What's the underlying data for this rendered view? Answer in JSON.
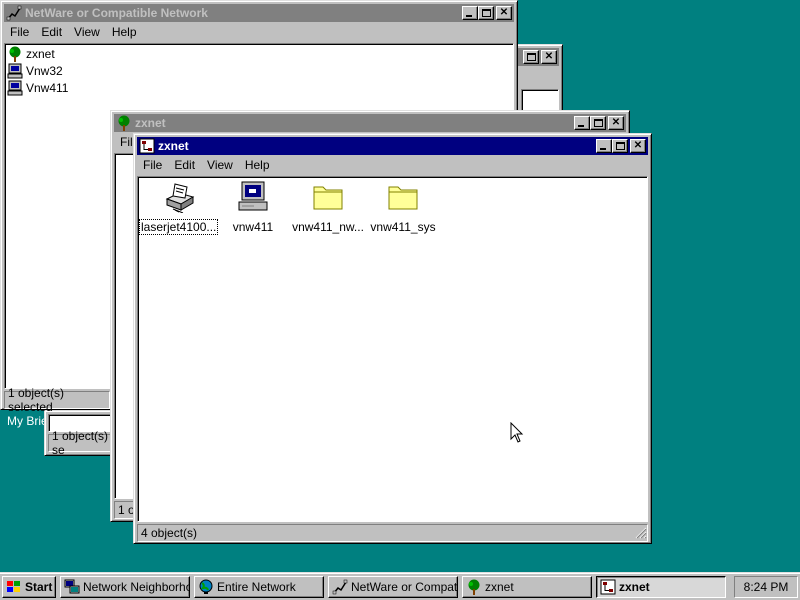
{
  "colors": {
    "desktop": "#008080",
    "active_title": "#000080",
    "inactive_title": "#808080",
    "face": "#c0c0c0"
  },
  "desktop": {
    "partial_label": "My Brief"
  },
  "network_window": {
    "title": "NetWare or Compatible Network",
    "menu": [
      "File",
      "Edit",
      "View",
      "Help"
    ],
    "items": [
      {
        "label": "zxnet",
        "icon": "tree-icon"
      },
      {
        "label": "Vnw32",
        "icon": "computer-icon"
      },
      {
        "label": "Vnw411",
        "icon": "computer-icon"
      }
    ],
    "status": "1 object(s) selected"
  },
  "briefcase_window": {
    "status": "1 object(s) se"
  },
  "zxnet_back_window": {
    "title": "zxnet",
    "menu_partial": "Fil",
    "status_partial": "1 o"
  },
  "zxnet_front_window": {
    "title": "zxnet",
    "menu": [
      "File",
      "Edit",
      "View",
      "Help"
    ],
    "items": [
      {
        "label": "laserjet4100...",
        "icon": "printer-icon",
        "focused": true
      },
      {
        "label": "vnw411",
        "icon": "computer-icon"
      },
      {
        "label": "vnw411_nw...",
        "icon": "folder-icon"
      },
      {
        "label": "vnw411_sys",
        "icon": "folder-icon"
      }
    ],
    "status": "4 object(s)"
  },
  "taskbar": {
    "start_label": "Start",
    "buttons": [
      {
        "label": "Network Neighborho...",
        "icon": "network-neighborhood-icon"
      },
      {
        "label": "Entire Network",
        "icon": "globe-icon"
      },
      {
        "label": "NetWare or Compati...",
        "icon": "netware-icon"
      },
      {
        "label": "zxnet",
        "icon": "tree-icon"
      },
      {
        "label": "zxnet",
        "icon": "netware-tree-icon",
        "active": true
      }
    ],
    "clock": "8:24 PM"
  }
}
